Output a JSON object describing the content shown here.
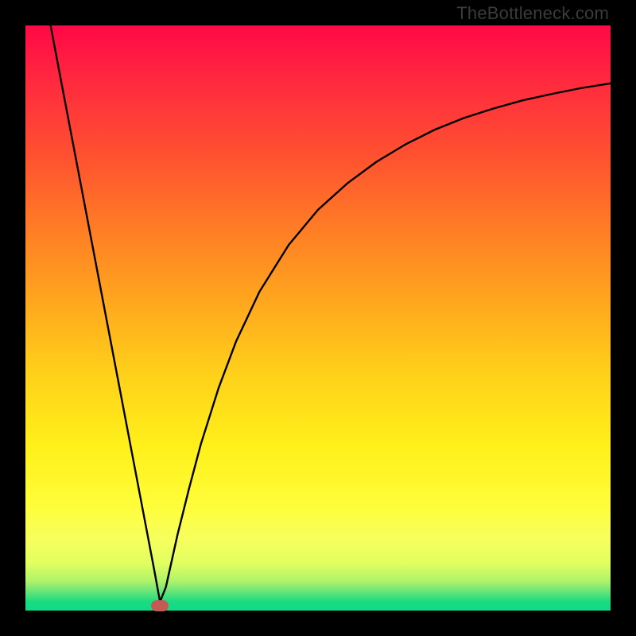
{
  "watermark": "TheBottleneck.com",
  "chart_data": {
    "type": "line",
    "title": "",
    "xlabel": "",
    "ylabel": "",
    "x_range": [
      0,
      100
    ],
    "y_range": [
      0,
      100
    ],
    "minimum_at_x": 23,
    "series": [
      {
        "name": "curve",
        "x": [
          4.3,
          6,
          8,
          10,
          12,
          14,
          16,
          18,
          20,
          22,
          23,
          24,
          26,
          28,
          30,
          33,
          36,
          40,
          45,
          50,
          55,
          60,
          65,
          70,
          75,
          80,
          85,
          90,
          95,
          100
        ],
        "values": [
          100,
          91,
          80.5,
          70,
          59.5,
          49,
          38.5,
          28,
          17.5,
          7,
          1.5,
          4,
          13,
          21,
          28.5,
          38,
          46,
          54.5,
          62.5,
          68.5,
          73,
          76.7,
          79.7,
          82.2,
          84.2,
          85.8,
          87.2,
          88.3,
          89.3,
          90.1
        ]
      }
    ],
    "gradient_stops": [
      {
        "pos": 0,
        "color": "#ff0846"
      },
      {
        "pos": 0.1,
        "color": "#ff2b3e"
      },
      {
        "pos": 0.22,
        "color": "#ff5030"
      },
      {
        "pos": 0.34,
        "color": "#ff7a26"
      },
      {
        "pos": 0.46,
        "color": "#ffa31e"
      },
      {
        "pos": 0.6,
        "color": "#ffd21a"
      },
      {
        "pos": 0.72,
        "color": "#fff01a"
      },
      {
        "pos": 0.82,
        "color": "#fffd3a"
      },
      {
        "pos": 0.88,
        "color": "#f6ff5e"
      },
      {
        "pos": 0.92,
        "color": "#e0ff60"
      },
      {
        "pos": 0.95,
        "color": "#aef26a"
      },
      {
        "pos": 0.97,
        "color": "#5de37a"
      },
      {
        "pos": 0.985,
        "color": "#18db82"
      },
      {
        "pos": 1.0,
        "color": "#13da86"
      }
    ],
    "dip_marker": {
      "x": 23,
      "y": 0.8,
      "color": "#c35b55"
    }
  }
}
